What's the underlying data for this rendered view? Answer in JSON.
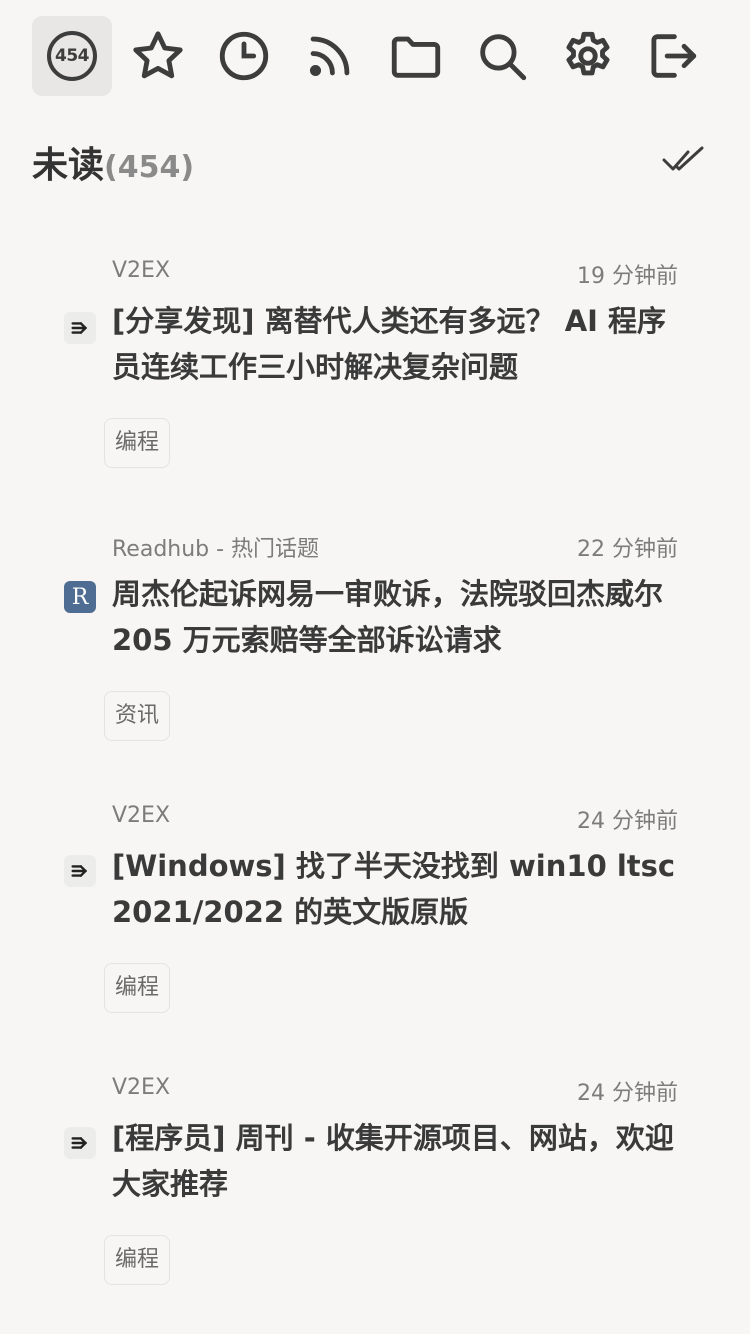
{
  "toolbar": {
    "unread_count_badge": "454",
    "buttons": [
      {
        "name": "unread",
        "icon": "count-badge-icon"
      },
      {
        "name": "starred",
        "icon": "star-icon"
      },
      {
        "name": "recent",
        "icon": "clock-icon"
      },
      {
        "name": "feeds",
        "icon": "rss-icon"
      },
      {
        "name": "folders",
        "icon": "folder-icon"
      },
      {
        "name": "search",
        "icon": "search-icon"
      },
      {
        "name": "settings",
        "icon": "gear-icon"
      },
      {
        "name": "logout",
        "icon": "logout-icon"
      }
    ]
  },
  "header": {
    "title": "未读",
    "count": "(454)",
    "mark_all_read_icon": "double-check-icon"
  },
  "articles": [
    {
      "source": "V2EX",
      "time": "19 分钟前",
      "title": "[分享发现] 离替代人类还有多远？ AI 程序员连续工作三小时解决复杂问题",
      "tag": "编程",
      "favicon": "v2ex-icon"
    },
    {
      "source": "Readhub - 热门话题",
      "time": "22 分钟前",
      "title": "周杰伦起诉网易一审败诉，法院驳回杰威尔 205 万元索赔等全部诉讼请求",
      "tag": "资讯",
      "favicon": "readhub-icon",
      "favicon_letter": "R"
    },
    {
      "source": "V2EX",
      "time": "24 分钟前",
      "title": "[Windows] 找了半天没找到 win10 ltsc 2021/2022 的英文版原版",
      "tag": "编程",
      "favicon": "v2ex-icon"
    },
    {
      "source": "V2EX",
      "time": "24 分钟前",
      "title": "[程序员] 周刊 - 收集开源项目、网站，欢迎大家推荐",
      "tag": "编程",
      "favicon": "v2ex-icon"
    }
  ],
  "colors": {
    "background": "#f7f6f4",
    "icon": "#3d3d3d",
    "text_primary": "#3a3a3a",
    "text_secondary": "#7c7c7c",
    "readhub_favicon_bg": "#4f6d92"
  }
}
